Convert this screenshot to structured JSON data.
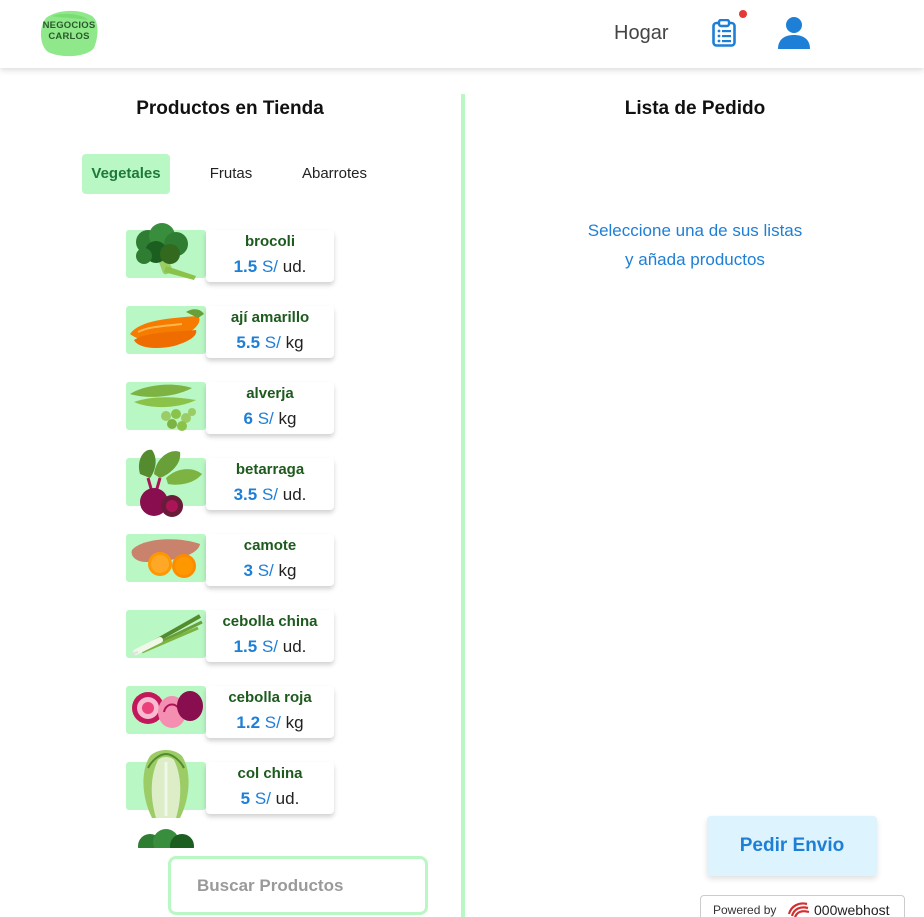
{
  "header": {
    "logo_text_line1": "NEGOCIOS",
    "logo_text_line2": "CARLOS",
    "nav_home": "Hogar",
    "icons": [
      "clipboard-list-icon",
      "user-icon"
    ]
  },
  "store": {
    "title": "Productos en Tienda",
    "tabs": [
      {
        "label": "Vegetales",
        "active": true
      },
      {
        "label": "Frutas",
        "active": false
      },
      {
        "label": "Abarrotes",
        "active": false
      }
    ],
    "products": [
      {
        "name": "brocoli",
        "price": "1.5",
        "currency": "S/",
        "unit": "ud."
      },
      {
        "name": "ají amarillo",
        "price": "5.5",
        "currency": "S/",
        "unit": "kg"
      },
      {
        "name": "alverja",
        "price": "6",
        "currency": "S/",
        "unit": "kg"
      },
      {
        "name": "betarraga",
        "price": "3.5",
        "currency": "S/",
        "unit": "ud."
      },
      {
        "name": "camote",
        "price": "3",
        "currency": "S/",
        "unit": "kg"
      },
      {
        "name": "cebolla china",
        "price": "1.5",
        "currency": "S/",
        "unit": "ud."
      },
      {
        "name": "cebolla roja",
        "price": "1.2",
        "currency": "S/",
        "unit": "kg"
      },
      {
        "name": "col china",
        "price": "5",
        "currency": "S/",
        "unit": "ud."
      }
    ],
    "search_placeholder": "Buscar Productos"
  },
  "order": {
    "title": "Lista de Pedido",
    "message_line1": "Seleccione una de sus listas",
    "message_line2": "y añada productos",
    "submit_label": "Pedir Envio"
  },
  "footer": {
    "powered_by": "Powered by",
    "brand": "000webhost"
  },
  "colors": {
    "accent_green": "#b9f7c4",
    "accent_blue": "#1e7fd6",
    "product_name_green": "#1d5a1d"
  }
}
